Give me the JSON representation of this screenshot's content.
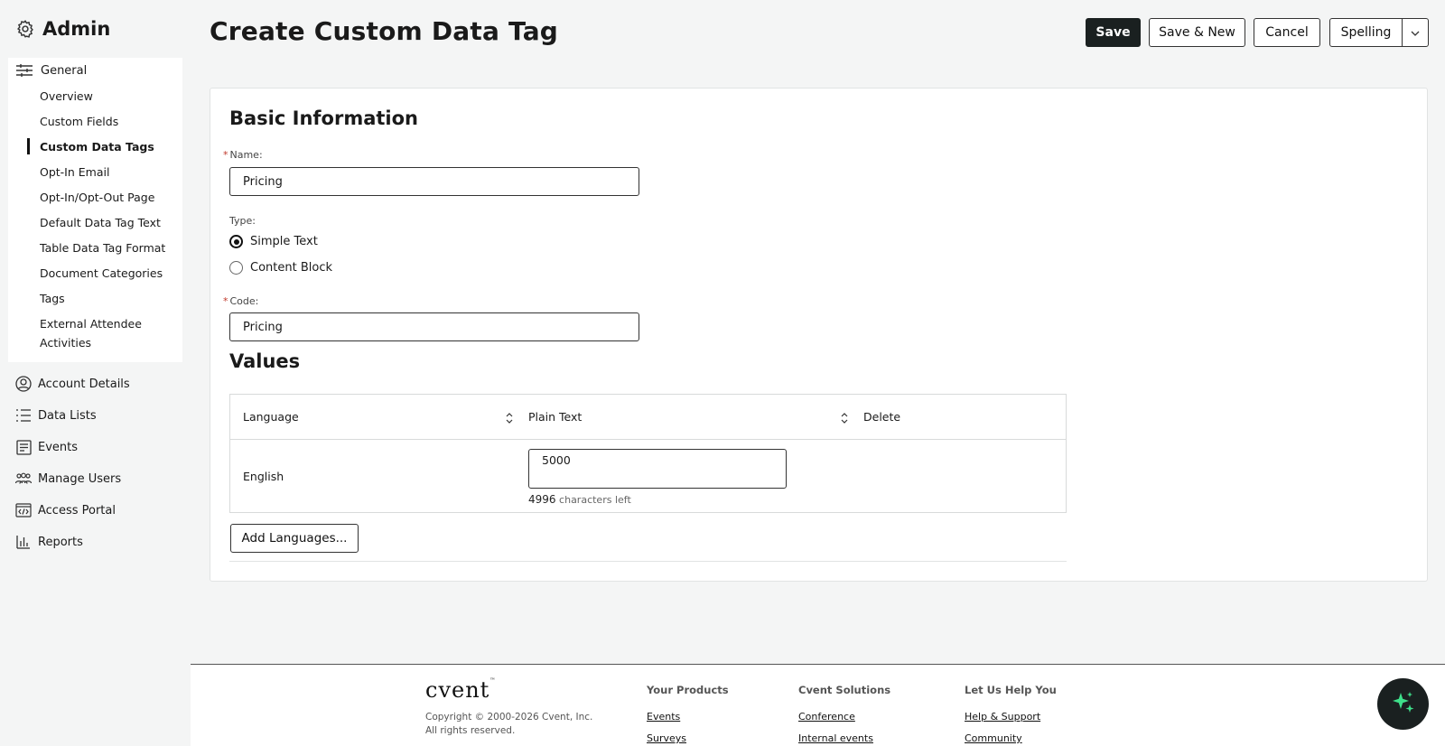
{
  "sidebar": {
    "title": "Admin",
    "general": {
      "label": "General",
      "items": [
        "Overview",
        "Custom Fields",
        "Custom Data Tags",
        "Opt-In Email",
        "Opt-In/Opt-Out Page",
        "Default Data Tag Text",
        "Table Data Tag Format",
        "Document Categories",
        "Tags",
        "External Attendee Activities"
      ],
      "active": "Custom Data Tags"
    },
    "nav": [
      {
        "label": "Account Details",
        "icon": "user-circle-icon"
      },
      {
        "label": "Data Lists",
        "icon": "list-icon"
      },
      {
        "label": "Events",
        "icon": "document-icon"
      },
      {
        "label": "Manage Users",
        "icon": "users-icon"
      },
      {
        "label": "Access Portal",
        "icon": "code-window-icon"
      },
      {
        "label": "Reports",
        "icon": "bar-chart-icon"
      }
    ]
  },
  "header": {
    "title": "Create Custom Data Tag",
    "save": "Save",
    "save_new": "Save & New",
    "cancel": "Cancel",
    "spelling": "Spelling"
  },
  "basic_info": {
    "title": "Basic Information",
    "name_label": "Name:",
    "name_value": "Pricing",
    "type_label": "Type:",
    "type_options": [
      "Simple Text",
      "Content Block"
    ],
    "type_selected": "Simple Text",
    "code_label": "Code:",
    "code_value": "Pricing"
  },
  "values": {
    "title": "Values",
    "columns": [
      "Language",
      "Plain Text",
      "Delete"
    ],
    "rows": [
      {
        "language": "English",
        "plain_text": "5000",
        "chars_left_count": "4996",
        "chars_left_text": "characters left"
      }
    ],
    "add_languages": "Add Languages..."
  },
  "footer": {
    "logo": "cvent",
    "copyright_line1": "Copyright © 2000-2026 Cvent, Inc.",
    "copyright_line2": "All rights reserved.",
    "col1": {
      "title": "Your Products",
      "links": [
        "Events",
        "Surveys"
      ]
    },
    "col2": {
      "title": "Cvent Solutions",
      "links": [
        "Conference",
        "Internal events"
      ]
    },
    "col3": {
      "title": "Let Us Help You",
      "links": [
        "Help & Support",
        "Community"
      ]
    }
  },
  "colors": {
    "primary": "#1a2020",
    "required": "#c0392b",
    "ai_sparkle": "#3ee08a"
  }
}
